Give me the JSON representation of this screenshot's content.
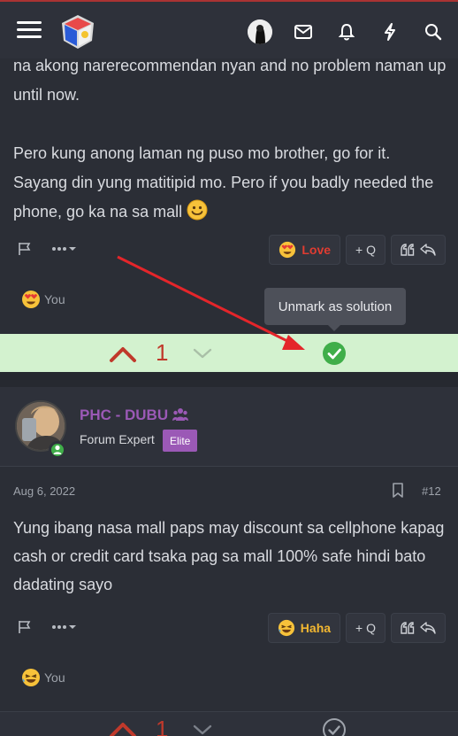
{
  "nav": {
    "icons": [
      "menu-icon",
      "site-logo",
      "user-avatar",
      "mail-icon",
      "bell-icon",
      "bolt-icon",
      "search-icon"
    ]
  },
  "post1": {
    "paragraphs": [
      "na akong narerecommendan nyan and no problem naman up until now.",
      "Pero kung anong laman ng puso mo brother, go for it. Sayang din yung matitipid mo. Pero if you badly needed the phone, go ka na sa mall"
    ],
    "reaction_label": "Love",
    "quote_label": "+ Q",
    "reacted_by": "You",
    "tooltip": "Unmark as solution",
    "vote_count": "1"
  },
  "post2": {
    "username": "PHC - DUBU",
    "user_title": "Forum Expert",
    "badge": "Elite",
    "date": "Aug 6, 2022",
    "post_number": "#12",
    "text": "Yung ibang nasa mall paps may discount sa cellphone kapag cash or credit card tsaka pag sa mall 100% safe hindi bato dadating sayo",
    "reaction_label": "Haha",
    "quote_label": "+ Q",
    "reacted_by": "You",
    "vote_count": "1"
  },
  "colors": {
    "background": "#2b2e36",
    "solution_bar": "#d3f2cf",
    "vote_red": "#c0392b",
    "solution_green": "#3fae49",
    "username_purple": "#9b59b6",
    "love_red": "#e03c31",
    "haha_gold": "#f2b731"
  }
}
